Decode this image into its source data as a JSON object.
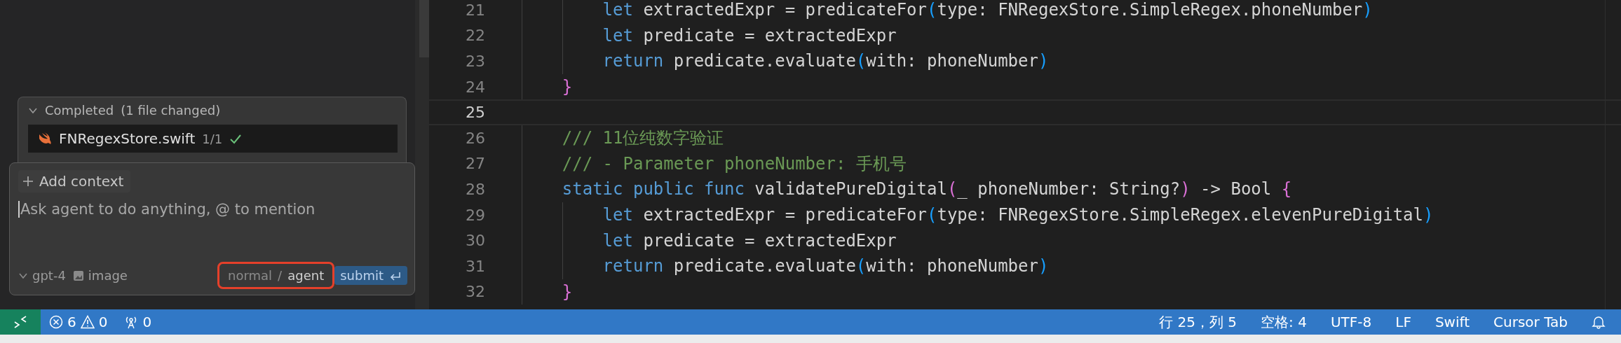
{
  "agent_panel": {
    "completed": {
      "label": "Completed",
      "detail": "(1 file changed)",
      "expanded": true,
      "files": [
        {
          "name": "FNRegexStore.swift",
          "changes": "1/1",
          "accepted": true
        }
      ]
    },
    "composer": {
      "add_context": "Add context",
      "placeholder": "Ask agent to do anything, @ to mention",
      "model": "gpt-4",
      "image_button": "image",
      "mode_switch": {
        "outlined": true,
        "separator": "/",
        "modes": [
          {
            "label": "normal",
            "selected": false
          },
          {
            "label": "agent",
            "selected": true
          }
        ]
      },
      "submit": "submit"
    }
  },
  "editor": {
    "lines": [
      {
        "number": "21",
        "current": false,
        "tokens": [
          {
            "kind": "keyword",
            "text": "        let"
          },
          {
            "kind": "plain",
            "text": " extractedExpr = predicateFor"
          },
          {
            "kind": "paren",
            "text": "("
          },
          {
            "kind": "plain",
            "text": "type: FNRegexStore.SimpleRegex.phoneNumber"
          },
          {
            "kind": "paren",
            "text": ")"
          }
        ]
      },
      {
        "number": "22",
        "current": false,
        "tokens": [
          {
            "kind": "keyword",
            "text": "        let"
          },
          {
            "kind": "plain",
            "text": " predicate = extractedExpr"
          }
        ]
      },
      {
        "number": "23",
        "current": false,
        "tokens": [
          {
            "kind": "keyword",
            "text": "        return"
          },
          {
            "kind": "plain",
            "text": " predicate.evaluate"
          },
          {
            "kind": "paren",
            "text": "("
          },
          {
            "kind": "plain",
            "text": "with: phoneNumber"
          },
          {
            "kind": "paren",
            "text": ")"
          }
        ]
      },
      {
        "number": "24",
        "current": false,
        "tokens": [
          {
            "kind": "brace",
            "text": "    }"
          }
        ]
      },
      {
        "number": "25",
        "current": true
      },
      {
        "number": "26",
        "current": false,
        "tokens": [
          {
            "kind": "comment",
            "text": "    /// 11位纯数字验证"
          }
        ]
      },
      {
        "number": "27",
        "current": false,
        "tokens": [
          {
            "kind": "comment",
            "text": "    /// - Parameter phoneNumber: 手机号"
          }
        ]
      },
      {
        "number": "28",
        "current": false,
        "tokens": [
          {
            "kind": "keyword",
            "text": "    static public func"
          },
          {
            "kind": "plain",
            "text": " validatePureDigital"
          },
          {
            "kind": "brace",
            "text": "("
          },
          {
            "kind": "plain",
            "text": "_ phoneNumber: String?"
          },
          {
            "kind": "brace",
            "text": ")"
          },
          {
            "kind": "plain",
            "text": " -> Bool "
          },
          {
            "kind": "brace",
            "text": "{"
          }
        ]
      },
      {
        "number": "29",
        "current": false,
        "tokens": [
          {
            "kind": "keyword",
            "text": "        let"
          },
          {
            "kind": "plain",
            "text": " extractedExpr = predicateFor"
          },
          {
            "kind": "paren",
            "text": "("
          },
          {
            "kind": "plain",
            "text": "type: FNRegexStore.SimpleRegex.elevenPureDigital"
          },
          {
            "kind": "paren",
            "text": ")"
          }
        ]
      },
      {
        "number": "30",
        "current": false,
        "tokens": [
          {
            "kind": "keyword",
            "text": "        let"
          },
          {
            "kind": "plain",
            "text": " predicate = extractedExpr"
          }
        ]
      },
      {
        "number": "31",
        "current": false,
        "tokens": [
          {
            "kind": "keyword",
            "text": "        return"
          },
          {
            "kind": "plain",
            "text": " predicate.evaluate"
          },
          {
            "kind": "paren",
            "text": "("
          },
          {
            "kind": "plain",
            "text": "with: phoneNumber"
          },
          {
            "kind": "paren",
            "text": ")"
          }
        ]
      },
      {
        "number": "32",
        "current": false,
        "tokens": [
          {
            "kind": "brace",
            "text": "    }"
          }
        ]
      }
    ]
  },
  "status_bar": {
    "errors": "6",
    "warnings": "0",
    "ports": "0",
    "items": [
      "行 25，列 5",
      "空格: 4",
      "UTF-8",
      "LF",
      "Swift",
      "Cursor Tab"
    ]
  }
}
